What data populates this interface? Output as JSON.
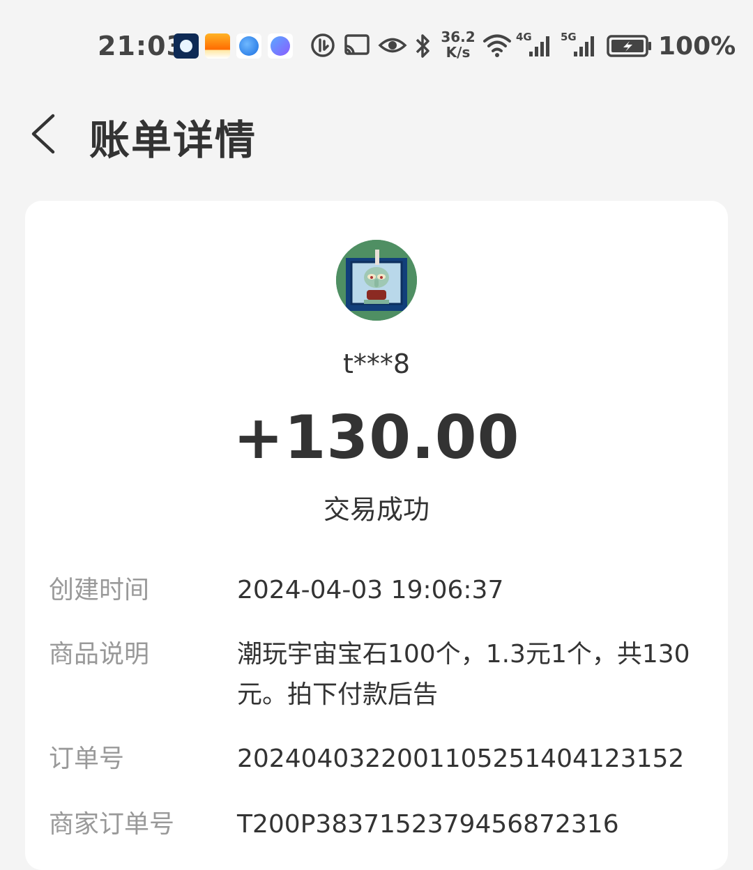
{
  "status_bar": {
    "time": "21:03",
    "apps": [
      "app-icon-1",
      "video-app-icon",
      "browser-icon",
      "music-app-icon"
    ],
    "speed_value": "36.2",
    "speed_unit": "K/s",
    "net_4g": "4G",
    "net_5g": "5G",
    "battery_percent": "100%"
  },
  "header": {
    "title": "账单详情"
  },
  "transaction": {
    "username": "t***8",
    "amount": "+130.00",
    "status": "交易成功"
  },
  "details": [
    {
      "label": "创建时间",
      "value": "2024-04-03 19:06:37"
    },
    {
      "label": "商品说明",
      "value": "潮玩宇宙宝石100个，1.3元1个，共130元。拍下付款后告"
    },
    {
      "label": "订单号",
      "value": "2024040322001105251404123152"
    },
    {
      "label": "商家订单号",
      "value": "T200P3837152379456872316"
    }
  ],
  "colors": {
    "background": "#f4f4f4",
    "card": "#ffffff",
    "primary_text": "#333333",
    "secondary_text": "#999999"
  }
}
